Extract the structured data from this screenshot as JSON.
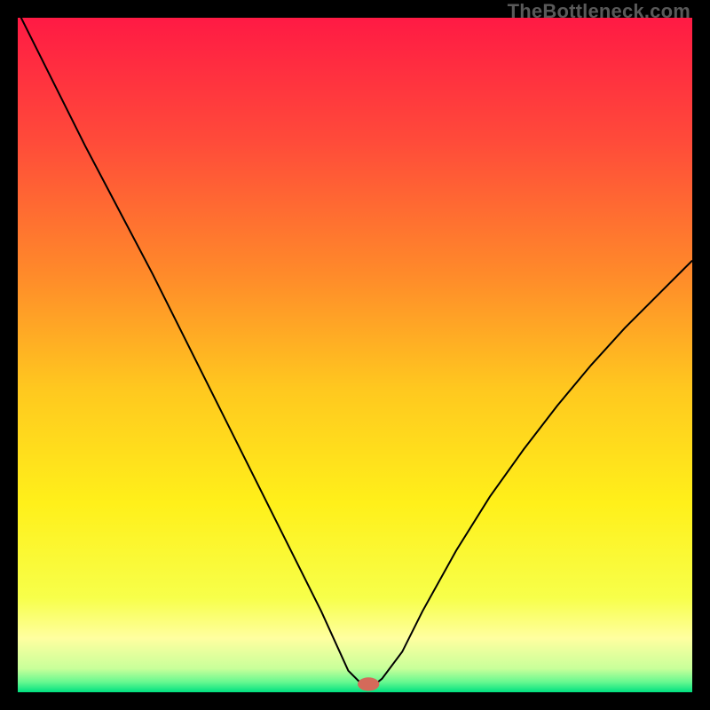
{
  "watermark": "TheBottleneck.com",
  "chart_data": {
    "type": "line",
    "title": "",
    "xlabel": "",
    "ylabel": "",
    "xlim": [
      0,
      100
    ],
    "ylim": [
      0,
      100
    ],
    "axes_visible": false,
    "grid": false,
    "background_gradient_stops": [
      {
        "offset": 0.0,
        "color": "#ff1a44"
      },
      {
        "offset": 0.18,
        "color": "#ff4a3a"
      },
      {
        "offset": 0.38,
        "color": "#ff8a2a"
      },
      {
        "offset": 0.55,
        "color": "#ffc81f"
      },
      {
        "offset": 0.72,
        "color": "#fff01a"
      },
      {
        "offset": 0.86,
        "color": "#f7ff4a"
      },
      {
        "offset": 0.92,
        "color": "#ffffa0"
      },
      {
        "offset": 0.965,
        "color": "#c8ff9a"
      },
      {
        "offset": 0.985,
        "color": "#66f890"
      },
      {
        "offset": 1.0,
        "color": "#00e080"
      }
    ],
    "series": [
      {
        "name": "bottleneck-curve",
        "stroke": "#000000",
        "stroke_width": 2,
        "x": [
          0,
          5,
          10,
          15,
          20,
          25,
          30,
          35,
          40,
          45,
          49,
          51,
          53,
          54,
          57,
          60,
          65,
          70,
          75,
          80,
          85,
          90,
          95,
          100
        ],
        "y": [
          101,
          91,
          81,
          71.5,
          62,
          52,
          42,
          32,
          22,
          12,
          3.2,
          1.2,
          1.2,
          2.0,
          6,
          12,
          21,
          29,
          36,
          42.5,
          48.5,
          54,
          59,
          64
        ]
      }
    ],
    "marker": {
      "name": "optimal-point",
      "x": 52,
      "y": 1.2,
      "rx": 1.6,
      "ry": 1.0,
      "fill": "#d46a5a"
    }
  }
}
